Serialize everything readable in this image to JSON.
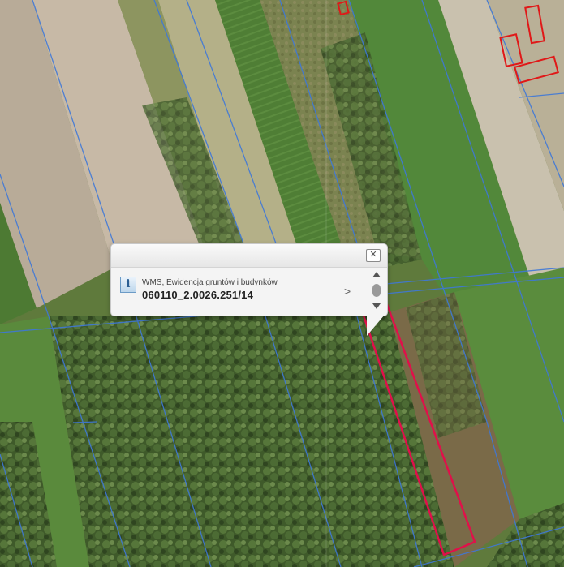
{
  "map": {
    "colors": {
      "parcel_lines": "#3f78d8",
      "selected_parcel": "#e0104a",
      "buildings": "#e01818"
    }
  },
  "popup": {
    "layer_name": "WMS, Ewidencja gruntów i budynków",
    "parcel_id": "060110_2.0026.251/14",
    "close_glyph": "✕",
    "next_glyph": ">",
    "info_glyph": "i"
  }
}
